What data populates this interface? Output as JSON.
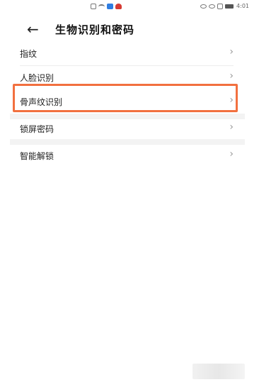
{
  "status_bar": {
    "time": "4:01",
    "center_icons": [
      "sim-icon",
      "wifi-icon",
      "message-icon",
      "huawei-icon"
    ],
    "right_icons": [
      "eye-icon",
      "nfc-icon",
      "signal-icon",
      "battery-icon"
    ]
  },
  "header": {
    "back_glyph": "←",
    "title": "生物识别和密码"
  },
  "items": [
    {
      "label": "指纹",
      "chevron": "›"
    },
    {
      "label": "人脸识别",
      "chevron": "›"
    },
    {
      "label": "骨声纹识别",
      "chevron": "›",
      "highlighted": true
    },
    {
      "label": "锁屏密码",
      "chevron": "›"
    },
    {
      "label": "智能解锁",
      "chevron": "›"
    }
  ],
  "colors": {
    "highlight": "#f2703f",
    "text": "#1d1d1d",
    "chevron": "#9a9a9a"
  }
}
